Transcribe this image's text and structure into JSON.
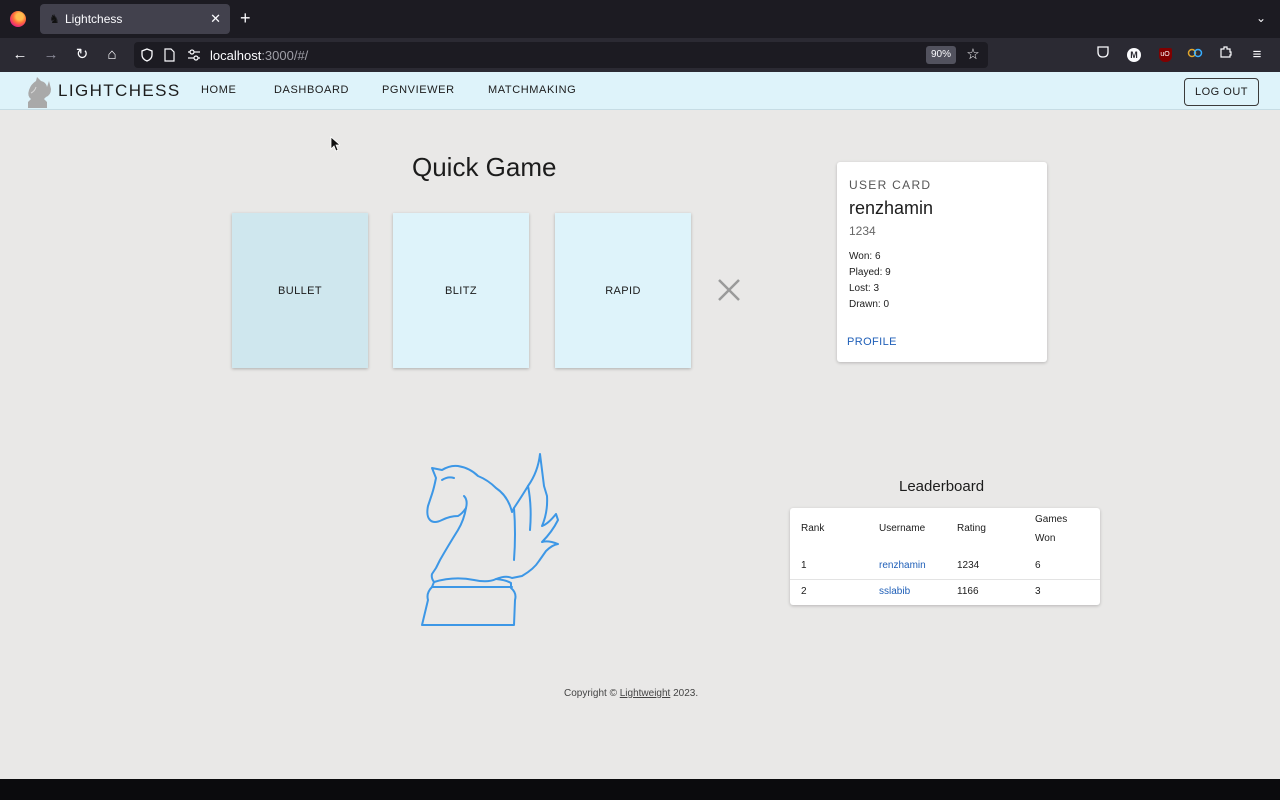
{
  "browser": {
    "tab_title": "Lightchess",
    "tab_favicon": "knight-favicon-icon",
    "url_host": "localhost",
    "url_rest": ":3000/#/",
    "zoom_level": "90%",
    "icons": [
      "back-icon",
      "forward-icon",
      "reload-icon",
      "home-icon",
      "shield-icon",
      "page-icon",
      "permissions-icon",
      "bookmark-star-icon",
      "pocket-icon",
      "account-icon",
      "ublock-icon",
      "container-icon",
      "extensions-icon",
      "menu-icon"
    ]
  },
  "app": {
    "brand": "LIGHTCHESS",
    "nav": [
      "HOME",
      "DASHBOARD",
      "PGNVIEWER",
      "MATCHMAKING"
    ],
    "logout": "LOG OUT",
    "accent_color": "#def3fa",
    "link_color": "#1f5fb8"
  },
  "quick_game": {
    "title": "Quick Game",
    "modes": [
      "BULLET",
      "BLITZ",
      "RAPID"
    ],
    "selected_mode": "BULLET"
  },
  "user_card": {
    "heading": "USER CARD",
    "username": "renzhamin",
    "rating": "1234",
    "stats": [
      "Won: 6",
      "Played: 9",
      "Lost: 3",
      "Drawn: 0"
    ],
    "profile_link": "PROFILE"
  },
  "leaderboard": {
    "title": "Leaderboard",
    "headers": [
      "Rank",
      "Username",
      "Rating",
      "Games",
      "Won"
    ],
    "rows": [
      [
        "1",
        "renzhamin",
        "1234",
        "6"
      ],
      [
        "2",
        "sslabib",
        "1166",
        "3"
      ]
    ]
  },
  "footer": {
    "prefix": "Copyright © ",
    "link": "Lightweight",
    "suffix": " 2023."
  }
}
